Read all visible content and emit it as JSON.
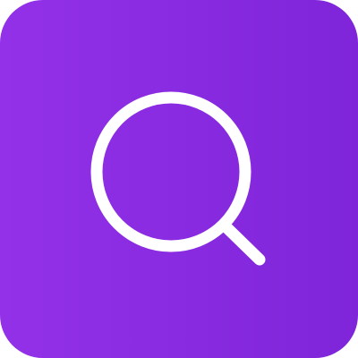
{
  "app_icon": {
    "icon": "search-icon",
    "colors": {
      "gradient_start": "#9331e8",
      "gradient_end": "#7f25d9",
      "glyph": "#ffffff"
    }
  }
}
